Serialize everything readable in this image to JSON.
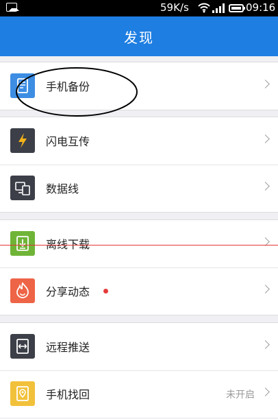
{
  "status_bar": {
    "speed": "59K/s",
    "time": "09:16"
  },
  "header": {
    "title": "发现"
  },
  "groups": [
    {
      "items": [
        {
          "label": "手机备份",
          "icon": "phone-backup-icon",
          "color": "#3d8de3"
        }
      ]
    },
    {
      "items": [
        {
          "label": "闪电互传",
          "icon": "lightning-icon",
          "color": "#3c3f48"
        },
        {
          "label": "数据线",
          "icon": "data-cable-icon",
          "color": "#3c3f48"
        }
      ]
    },
    {
      "items": [
        {
          "label": "离线下载",
          "icon": "offline-download-icon",
          "color": "#6fb437"
        },
        {
          "label": "分享动态",
          "icon": "share-feed-icon",
          "color": "#ee6446"
        }
      ]
    },
    {
      "items": [
        {
          "label": "远程推送",
          "icon": "remote-push-icon",
          "color": "#3c3f48"
        },
        {
          "label": "手机找回",
          "icon": "find-phone-icon",
          "color": "#f2c13b",
          "status": "未开启"
        }
      ]
    }
  ]
}
